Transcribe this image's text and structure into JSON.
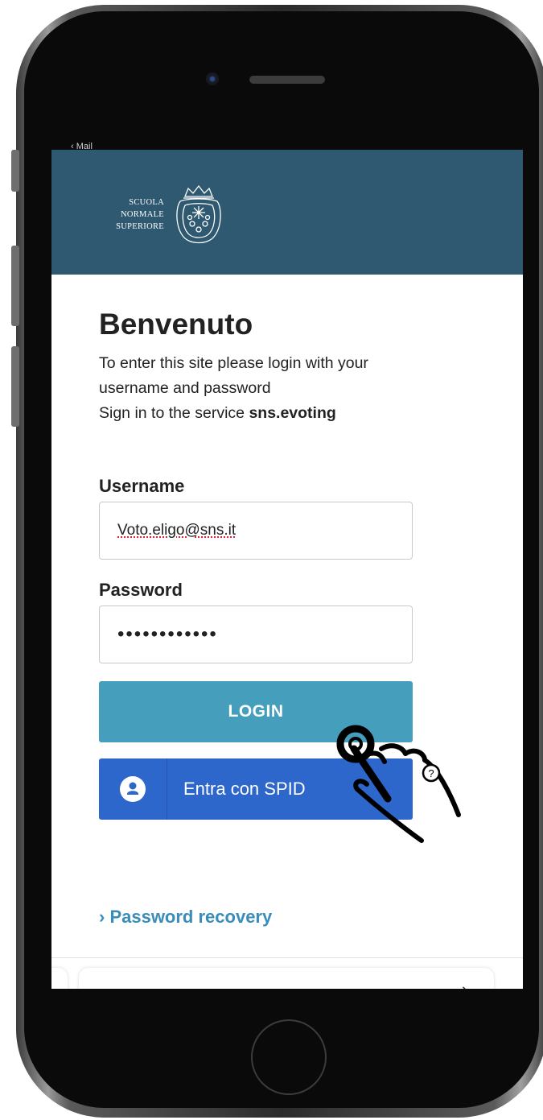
{
  "status_sliver": "‹ Mail",
  "header": {
    "logo_lines": [
      "SCUOLA",
      "NORMALE",
      "SUPERIORE"
    ]
  },
  "login": {
    "title": "Benvenuto",
    "desc_line1": "To enter this site please login with your",
    "desc_line2": "username and password",
    "desc_line3_prefix": "Sign in to the service ",
    "service_name": "sns.evoting",
    "username_label": "Username",
    "username_value": "Voto.eligo@sns.it",
    "password_label": "Password",
    "password_mask": "••••••••••••",
    "login_button": "LOGIN",
    "spid_button": "Entra con SPID",
    "recovery_link": "› Password recovery"
  },
  "icons": {
    "crest": "sns-crest-icon",
    "spid": "user-icon",
    "help": "help-icon",
    "chevron": "chevron-right-icon",
    "hand": "hand-pointer-icon"
  },
  "colors": {
    "header_bg": "#2f5970",
    "login_btn": "#469ebd",
    "spid_btn": "#2e67cc",
    "link": "#3a8db8"
  }
}
